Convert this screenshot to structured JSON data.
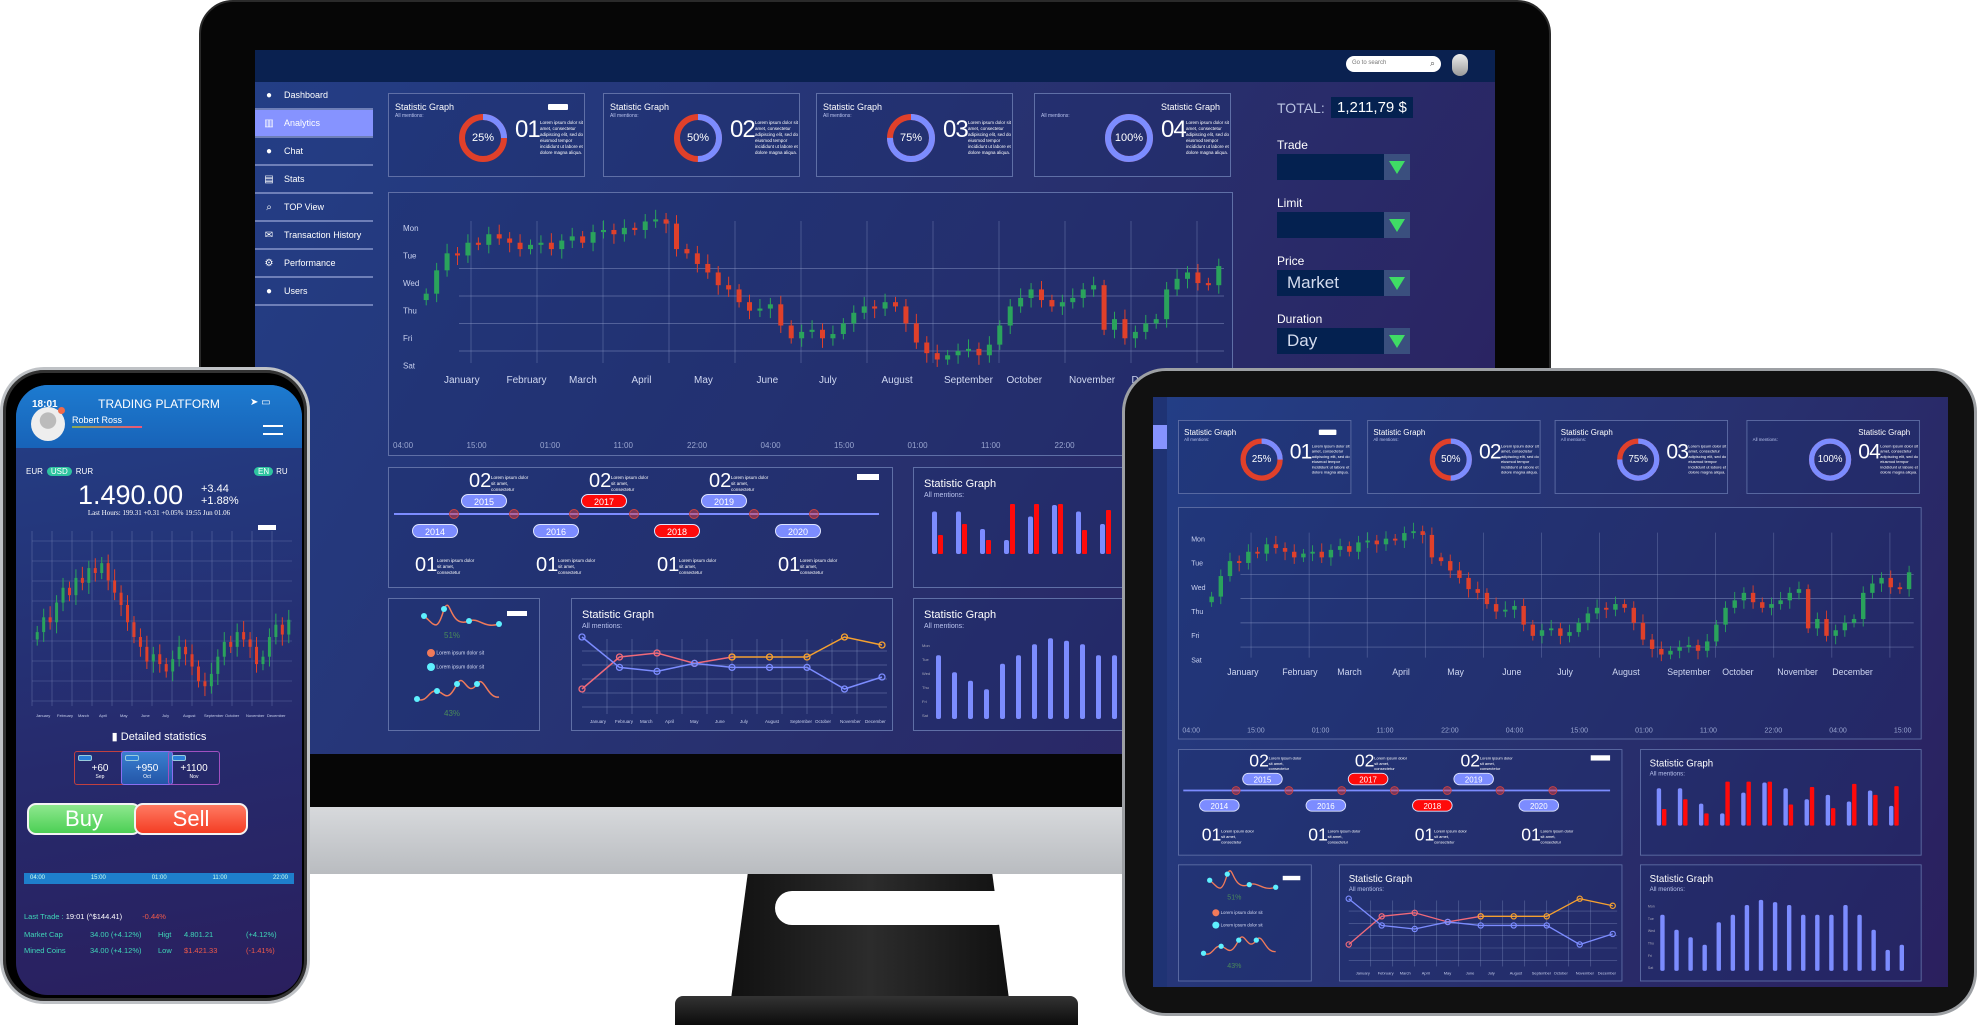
{
  "colors": {
    "accent_blue": "#7c8cff",
    "accent_red": "#e0402a",
    "up": "#2aa35c",
    "down": "#e0402a",
    "buy": "#4fd65e",
    "sell": "#f24a2e",
    "background": "#28306e"
  },
  "monitor": {
    "search_placeholder": "Go to search",
    "sidebar": [
      {
        "label": "Dashboard",
        "icon": "user-icon"
      },
      {
        "label": "Analytics",
        "icon": "bar-chart-icon",
        "active": true
      },
      {
        "label": "Chat",
        "icon": "chat-bubble-icon"
      },
      {
        "label": "Stats",
        "icon": "stats-icon"
      },
      {
        "label": "TOP View",
        "icon": "search-icon"
      },
      {
        "label": "Transaction History",
        "icon": "envelope-icon"
      },
      {
        "label": "Performance",
        "icon": "gear-icon"
      },
      {
        "label": "Users",
        "icon": "users-icon"
      }
    ],
    "right": {
      "total_label": "TOTAL:",
      "total_value": "1,211,79 $",
      "fields": [
        {
          "label": "Trade",
          "value": ""
        },
        {
          "label": "Limit",
          "value": ""
        },
        {
          "label": "Price",
          "value": "Market"
        },
        {
          "label": "Duration",
          "value": "Day"
        }
      ]
    }
  },
  "main": {
    "cards": [
      {
        "title": "Statistic Graph",
        "sub": "All mentions:",
        "percent": 25,
        "pct_label": "25%",
        "num": "01",
        "lorem": "Lorem ipsum dolor sit amet, consectetur adipiscing elit, sed do eiusmod tempor incididunt ut labore et dolore magna aliqua."
      },
      {
        "title": "Statistic Graph",
        "sub": "All mentions:",
        "percent": 50,
        "pct_label": "50%",
        "num": "02",
        "lorem": "Lorem ipsum dolor sit amet, consectetur adipiscing elit, sed do eiusmod tempor incididunt ut labore et dolore magna aliqua."
      },
      {
        "title": "Statistic Graph",
        "sub": "All mentions:",
        "percent": 75,
        "pct_label": "75%",
        "num": "03",
        "lorem": "Lorem ipsum dolor sit amet, consectetur adipiscing elit, sed do eiusmod tempor incididunt ut labore et dolore magna aliqua."
      },
      {
        "title": "Statistic Graph",
        "sub": "All mentions:",
        "percent": 100,
        "pct_label": "100%",
        "num": "04",
        "lorem": "Lorem ipsum dolor sit amet, consectetur adipiscing elit, sed do eiusmod tempor incididunt ut labore et dolore magna aliqua."
      }
    ],
    "candle": {
      "y_labels": [
        "Mon",
        "Tue",
        "Wed",
        "Thu",
        "Fri",
        "Sat"
      ],
      "months": [
        "January",
        "February",
        "March",
        "April",
        "May",
        "June",
        "July",
        "August",
        "September",
        "October",
        "November",
        "December"
      ],
      "times": [
        "04:00",
        "15:00",
        "01:00",
        "11:00",
        "22:00",
        "04:00",
        "15:00",
        "01:00",
        "11:00",
        "22:00",
        "04:00",
        "15:00"
      ],
      "first_open": 2.9,
      "closes": [
        3.2,
        4.3,
        5.1,
        5.0,
        5.6,
        5.5,
        6.0,
        5.8,
        5.6,
        5.3,
        5.5,
        5.6,
        5.3,
        5.7,
        5.9,
        5.6,
        6.1,
        6.2,
        6.0,
        6.3,
        6.2,
        6.6,
        6.7,
        6.5,
        5.3,
        5.1,
        4.6,
        4.2,
        3.6,
        3.4,
        2.8,
        2.4,
        2.5,
        2.7,
        1.7,
        1.1,
        1.4,
        1.5,
        1.1,
        1.3,
        1.8,
        2.3,
        2.6,
        2.5,
        2.8,
        2.6,
        1.8,
        0.9,
        0.4,
        0.1,
        0.3,
        0.5,
        0.6,
        0.3,
        0.8,
        1.7,
        2.6,
        3.0,
        3.4,
        2.9,
        2.6,
        2.8,
        3.0,
        3.4,
        3.6,
        1.5,
        2.0,
        1.1,
        1.4,
        1.8,
        2.0,
        3.4,
        3.9,
        4.2,
        3.7,
        3.6,
        4.5
      ]
    },
    "timeline": {
      "top": [
        {
          "year": "2015",
          "num": "02",
          "red": false
        },
        {
          "year": "2017",
          "num": "02",
          "red": true
        },
        {
          "year": "2019",
          "num": "02",
          "red": false
        }
      ],
      "bottom": [
        {
          "year": "2014",
          "num": "01",
          "red": false
        },
        {
          "year": "2016",
          "num": "01",
          "red": false
        },
        {
          "year": "2018",
          "num": "01",
          "red": true
        },
        {
          "year": "2020",
          "num": "01",
          "red": false
        }
      ],
      "text": "Lorem ipsum dolor sit amet, consectetur"
    },
    "bars1": {
      "title": "Statistic Graph",
      "sub": "All mentions:",
      "blue": [
        85,
        85,
        50,
        28,
        75,
        98,
        85,
        60,
        70,
        55,
        80,
        45
      ],
      "red": [
        38,
        60,
        28,
        100,
        100,
        100,
        48,
        88,
        40,
        95,
        70,
        90
      ]
    },
    "widget": {
      "pct1": "51%",
      "pct2": "43%",
      "legend1": "Lorem ipsum dolor sit",
      "legend2": "Lorem ipsum dolor sit"
    },
    "line": {
      "title": "Statistic Graph",
      "sub": "All mentions:",
      "months": [
        "January",
        "February",
        "March",
        "April",
        "May",
        "June",
        "July",
        "August",
        "September",
        "October",
        "November",
        "December"
      ],
      "blue": [
        100,
        62,
        57,
        67,
        62,
        62,
        62,
        35,
        50
      ],
      "pink": [
        35,
        75,
        80,
        67,
        75
      ],
      "orange": [
        null,
        null,
        null,
        null,
        75,
        75,
        75,
        100,
        90
      ]
    },
    "bars2": {
      "title": "Statistic Graph",
      "sub": "All mentions:",
      "values": [
        75,
        55,
        45,
        35,
        65,
        75,
        88,
        95,
        92,
        88,
        75,
        75,
        75,
        88,
        75,
        55,
        28,
        35
      ]
    }
  },
  "phone": {
    "time": "18:01",
    "title": "TRADING PLATFORM",
    "user": "Robert Ross",
    "currencies": [
      "EUR",
      "USD",
      "RUR"
    ],
    "languages": [
      "EN",
      "RU"
    ],
    "price": "1.490.00",
    "change_abs": "+3.44",
    "change_pct": "+1.88%",
    "last_hours": "Last Hours: 199.31 +0.31  +0.05%  19:55 Jun 01.06",
    "closes": [
      2.8,
      3.4,
      3.2,
      4.0,
      4.6,
      4.3,
      5.0,
      4.8,
      5.4,
      5.2,
      5.6,
      4.9,
      4.4,
      3.9,
      3.2,
      2.6,
      2.2,
      1.6,
      1.9,
      1.5,
      1.2,
      1.7,
      2.2,
      1.9,
      1.4,
      0.8,
      0.6,
      1.1,
      1.8,
      2.4,
      2.2,
      2.8,
      2.5,
      2.2,
      1.5,
      1.8,
      2.6,
      3.1,
      2.7,
      3.3
    ],
    "detail_title": "Detailed statistics",
    "stats": [
      {
        "value": "+60",
        "month": "Sep"
      },
      {
        "value": "+950",
        "month": "Oct"
      },
      {
        "value": "+1100",
        "month": "Nov"
      }
    ],
    "buy": "Buy",
    "sell": "Sell",
    "times": [
      "04:00",
      "15:00",
      "01:00",
      "11:00",
      "22:00"
    ],
    "last_trade_label": "Last Trade :",
    "last_trade_value": "19:01 (^$144.41)",
    "last_trade_change": "-0.44%",
    "rows": [
      {
        "label": "Market Cap",
        "value": "34.00 (+4.12%)",
        "label2": "Higt",
        "value2": "4.801.21",
        "change2": "(+4.12%)"
      },
      {
        "label": "Mined Coins",
        "value": "34.00 (+4.12%)",
        "label2": "Low",
        "value2": "$1.421.33",
        "change2": "(-1.41%)"
      }
    ]
  }
}
